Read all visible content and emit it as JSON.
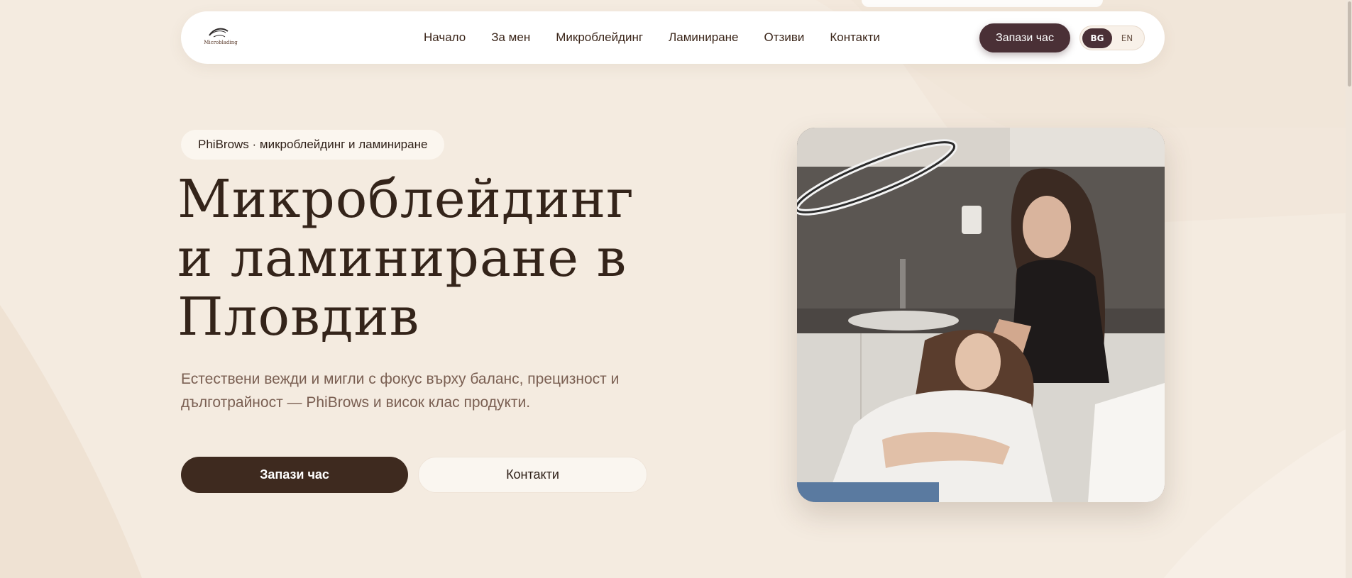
{
  "header": {
    "logo_text": "Microblading",
    "nav": [
      {
        "label": "Начало"
      },
      {
        "label": "За мен"
      },
      {
        "label": "Микроблейдинг"
      },
      {
        "label": "Ламиниране"
      },
      {
        "label": "Отзиви"
      },
      {
        "label": "Контакти"
      }
    ],
    "book_label": "Запази час",
    "lang": {
      "bg": "BG",
      "en": "EN",
      "active": "BG"
    }
  },
  "hero": {
    "badge": "PhiBrows · микроблейдинг и ламиниране",
    "title": "Микроблейдинг и ламиниране в Пловдив",
    "subtitle": "Естествени вежди и мигли с фокус върху баланс, прецизност и дълготрайност — PhiBrows и висок клас продукти.",
    "primary_button": "Запази час",
    "secondary_button": "Контакти"
  },
  "colors": {
    "background": "#f4ebe0",
    "accent_dark": "#3e2a1f",
    "button_plum": "#4a3036",
    "text": "#34241a"
  },
  "icons": {
    "logo": "eyebrow-logo-icon"
  }
}
